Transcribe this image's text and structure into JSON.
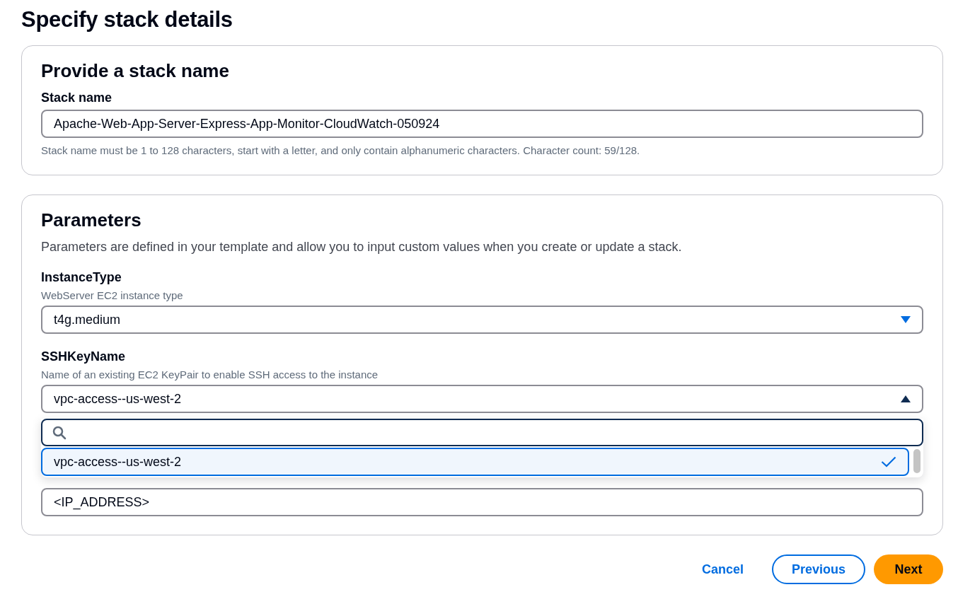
{
  "page_title": "Specify stack details",
  "stack_name_section": {
    "title": "Provide a stack name",
    "label": "Stack name",
    "value": "Apache-Web-App-Server-Express-App-Monitor-CloudWatch-050924",
    "hint": "Stack name must be 1 to 128 characters, start with a letter, and only contain alphanumeric characters. Character count: 59/128."
  },
  "parameters_section": {
    "title": "Parameters",
    "description": "Parameters are defined in your template and allow you to input custom values when you create or update a stack.",
    "parameters": [
      {
        "kind": "select",
        "label": "InstanceType",
        "description": "WebServer EC2 instance type",
        "value": "t4g.medium",
        "expanded": false
      },
      {
        "kind": "select",
        "label": "SSHKeyName",
        "description": "Name of an existing EC2 KeyPair to enable SSH access to the instance",
        "value": "vpc-access--us-west-2",
        "expanded": true,
        "options": [
          {
            "label": "vpc-access--us-west-2",
            "selected": true
          }
        ]
      },
      {
        "kind": "text",
        "value": "<IP_ADDRESS>"
      }
    ]
  },
  "buttons": [
    {
      "kind": "link",
      "label": "Cancel"
    },
    {
      "kind": "secondary",
      "label": "Previous"
    },
    {
      "kind": "primary",
      "label": "Next"
    }
  ]
}
